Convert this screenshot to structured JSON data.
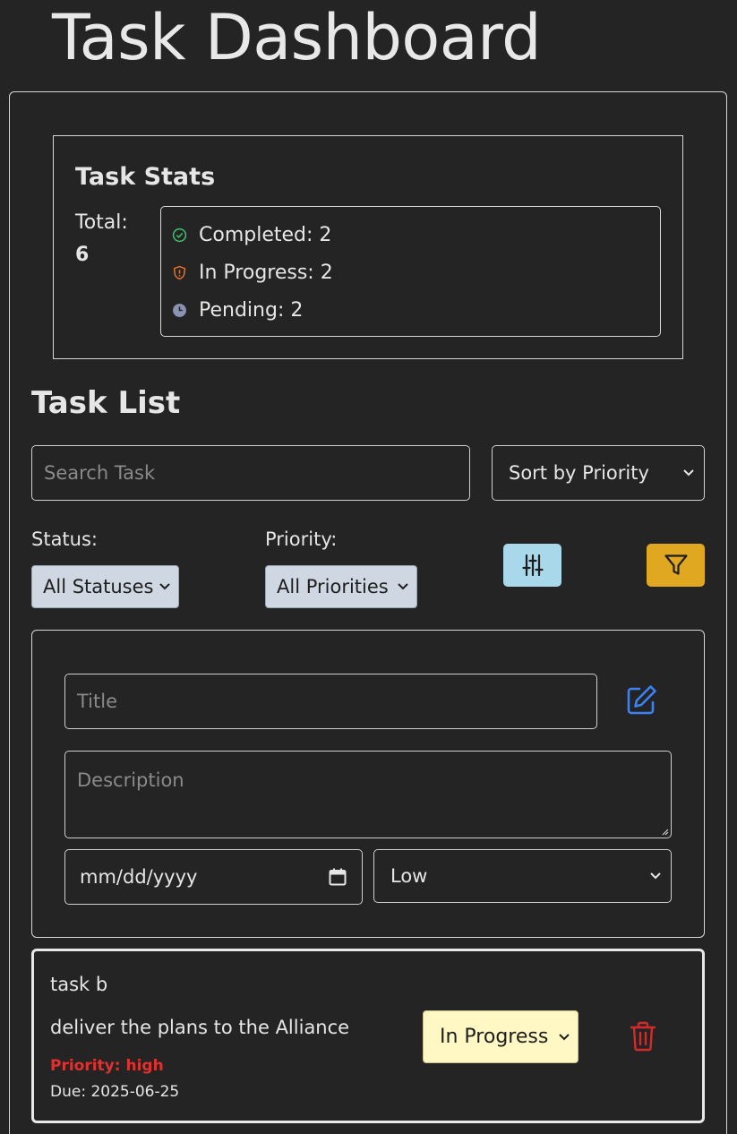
{
  "header": {
    "title": "Task Dashboard"
  },
  "stats": {
    "title": "Task Stats",
    "total_label": "Total:",
    "total_value": "6",
    "completed": "Completed: 2",
    "in_progress": "In Progress: 2",
    "pending": "Pending: 2",
    "colors": {
      "completed": "#3ec46d",
      "in_progress": "#e8732a",
      "pending": "#8a93b3"
    }
  },
  "task_list": {
    "title": "Task List",
    "search_placeholder": "Search Task",
    "sort_value": "Sort by Priority",
    "status_label": "Status:",
    "status_value": "All Statuses",
    "priority_label": "Priority:",
    "priority_value": "All Priorities",
    "controls": {
      "sliders_icon": "sliders-icon",
      "filter_icon": "funnel-icon"
    }
  },
  "form": {
    "title_placeholder": "Title",
    "description_placeholder": "Description",
    "date_placeholder": "mm/dd/yyyy",
    "priority_value": "Low",
    "edit_icon": "edit-icon"
  },
  "tasks": [
    {
      "title": "task b",
      "description": "deliver the plans to the Alliance",
      "priority": "Priority: high",
      "due": "Due: 2025-06-25",
      "status": "In Progress",
      "delete_icon": "trash-icon"
    }
  ]
}
